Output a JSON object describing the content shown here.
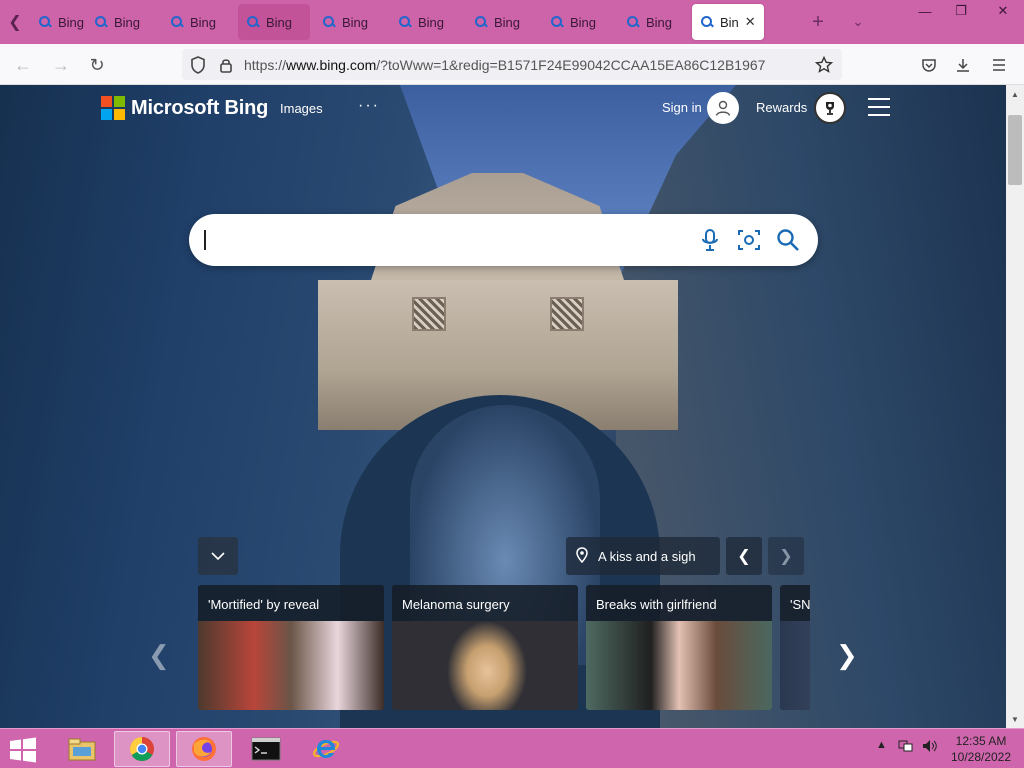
{
  "browser": {
    "tabs": [
      {
        "label": "Bing",
        "active": false
      },
      {
        "label": "Bing",
        "active": false
      },
      {
        "label": "Bing",
        "active": false
      },
      {
        "label": "Bing",
        "active": false
      },
      {
        "label": "Bing",
        "active": false
      },
      {
        "label": "Bing",
        "active": false
      },
      {
        "label": "Bing",
        "active": false
      },
      {
        "label": "Bing",
        "active": false
      },
      {
        "label": "Bing",
        "active": false
      },
      {
        "label": "Bin",
        "active": true
      }
    ],
    "url_prefix": "https://",
    "url_host": "www.bing.com",
    "url_path": "/?toWww=1&redig=B1571F24E99042CCAA15EA86C12B1967",
    "colors": {
      "tabstrip": "#cd63a8",
      "navbar": "#f9f9fb"
    }
  },
  "bing": {
    "logo_text": "Microsoft Bing",
    "nav_images": "Images",
    "nav_more": "···",
    "sign_in": "Sign in",
    "rewards": "Rewards",
    "search_value": "",
    "location_label": "A kiss and a sigh",
    "cards": [
      {
        "title": "'Mortified' by reveal"
      },
      {
        "title": "Melanoma surgery"
      },
      {
        "title": "Breaks with girlfriend"
      },
      {
        "title": "'SN"
      }
    ],
    "logo_colors": [
      "#f25022",
      "#7fba00",
      "#00a4ef",
      "#ffb900"
    ]
  },
  "taskbar": {
    "apps": [
      "file-explorer",
      "chrome",
      "firefox",
      "cmd",
      "internet-explorer"
    ],
    "time": "12:35 AM",
    "date": "10/28/2022"
  }
}
